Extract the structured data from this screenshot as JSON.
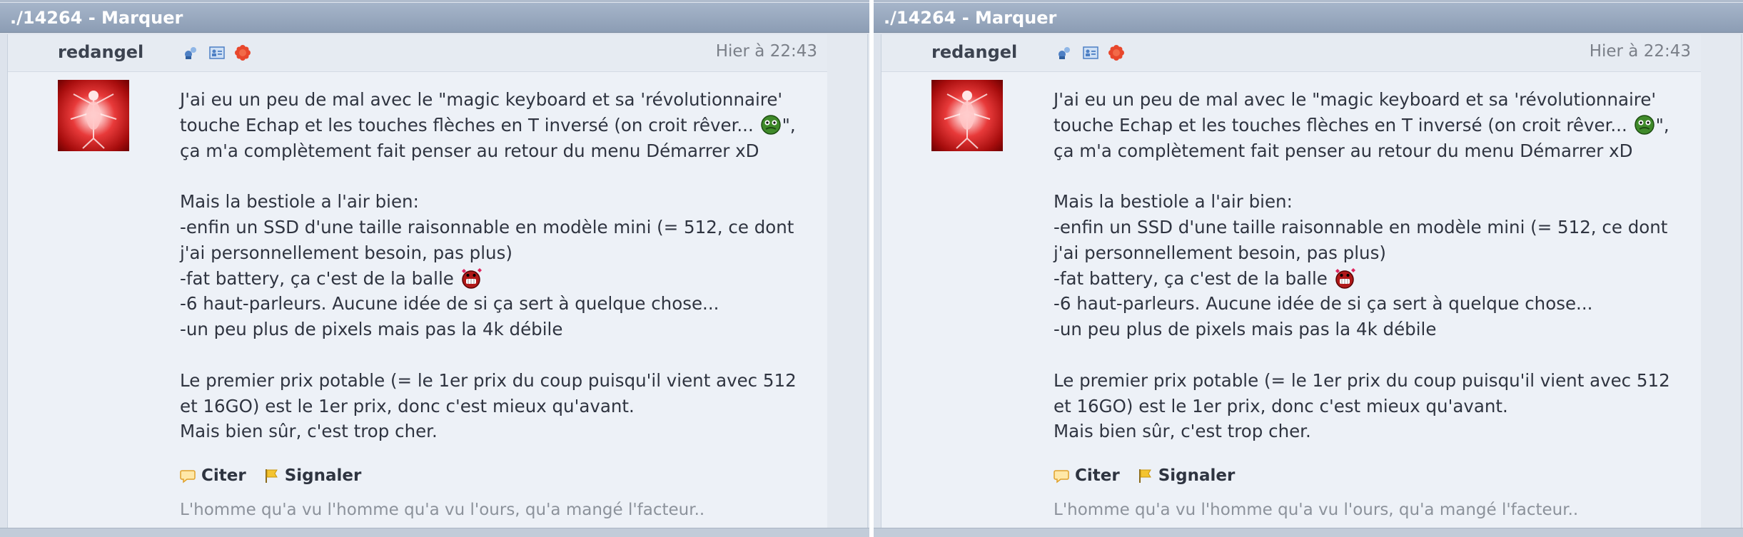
{
  "panels": [
    {
      "title": "./14264 - Marquer",
      "username": "redangel",
      "header_icons": [
        "profile-icon",
        "contact-card-icon",
        "status-flower-icon"
      ],
      "date": "Hier à 22:43",
      "lines": [
        "J'ai eu un peu de mal avec le \"magic keyboard et sa 'révolutionnaire' touche Echap et les touches flèches en T inversé (on croit rêver... ",
        "\", ça m'a complètement fait penser au retour du menu Démarrer xD",
        "Mais la bestiole a l'air bien:",
        "-enfin un SSD d'une taille raisonnable en modèle mini (= 512, ce dont j'ai personnellement besoin, pas plus)",
        "-fat battery, ça c'est de la balle ",
        "-6 haut-parleurs. Aucune idée de si ça sert à quelque chose...",
        "-un peu plus de pixels mais pas la 4k débile",
        "Le premier prix potable (= le 1er prix du coup puisqu'il vient avec 512 et 16GO) est le 1er prix, donc c'est mieux qu'avant.",
        "Mais bien sûr, c'est trop cher."
      ],
      "actions": {
        "quote": "Citer",
        "report": "Signaler"
      },
      "signature": "L'homme qu'a vu l'homme qu'a vu l'ours, qu'a mangé l'facteur.."
    },
    {
      "title": "./14264 - Marquer",
      "username": "redangel",
      "header_icons": [
        "profile-icon",
        "contact-card-icon",
        "status-flower-icon"
      ],
      "date": "Hier à 22:43",
      "lines": [
        "J'ai eu un peu de mal avec le \"magic keyboard et sa 'révolutionnaire' touche Echap et les touches flèches en T inversé (on croit rêver... ",
        "\", ça m'a complètement fait penser au retour du menu Démarrer xD",
        "Mais la bestiole a l'air bien:",
        "-enfin un SSD d'une taille raisonnable en modèle mini (= 512, ce dont j'ai personnellement besoin, pas plus)",
        "-fat battery, ça c'est de la balle ",
        "-6 haut-parleurs. Aucune idée de si ça sert à quelque chose...",
        "-un peu plus de pixels mais pas la 4k débile",
        "Le premier prix potable (= le 1er prix du coup puisqu'il vient avec 512 et 16GO) est le 1er prix, donc c'est mieux qu'avant.",
        "Mais bien sûr, c'est trop cher."
      ],
      "actions": {
        "quote": "Citer",
        "report": "Signaler"
      },
      "signature": "L'homme qu'a vu l'homme qu'a vu l'ours, qu'a mangé l'facteur.."
    }
  ],
  "colors": {
    "title_bar": "#97a7bd",
    "post_background": "#edf1f7",
    "text": "#2f3440",
    "signature": "#8c929b",
    "avatar_red": "#d42424"
  }
}
